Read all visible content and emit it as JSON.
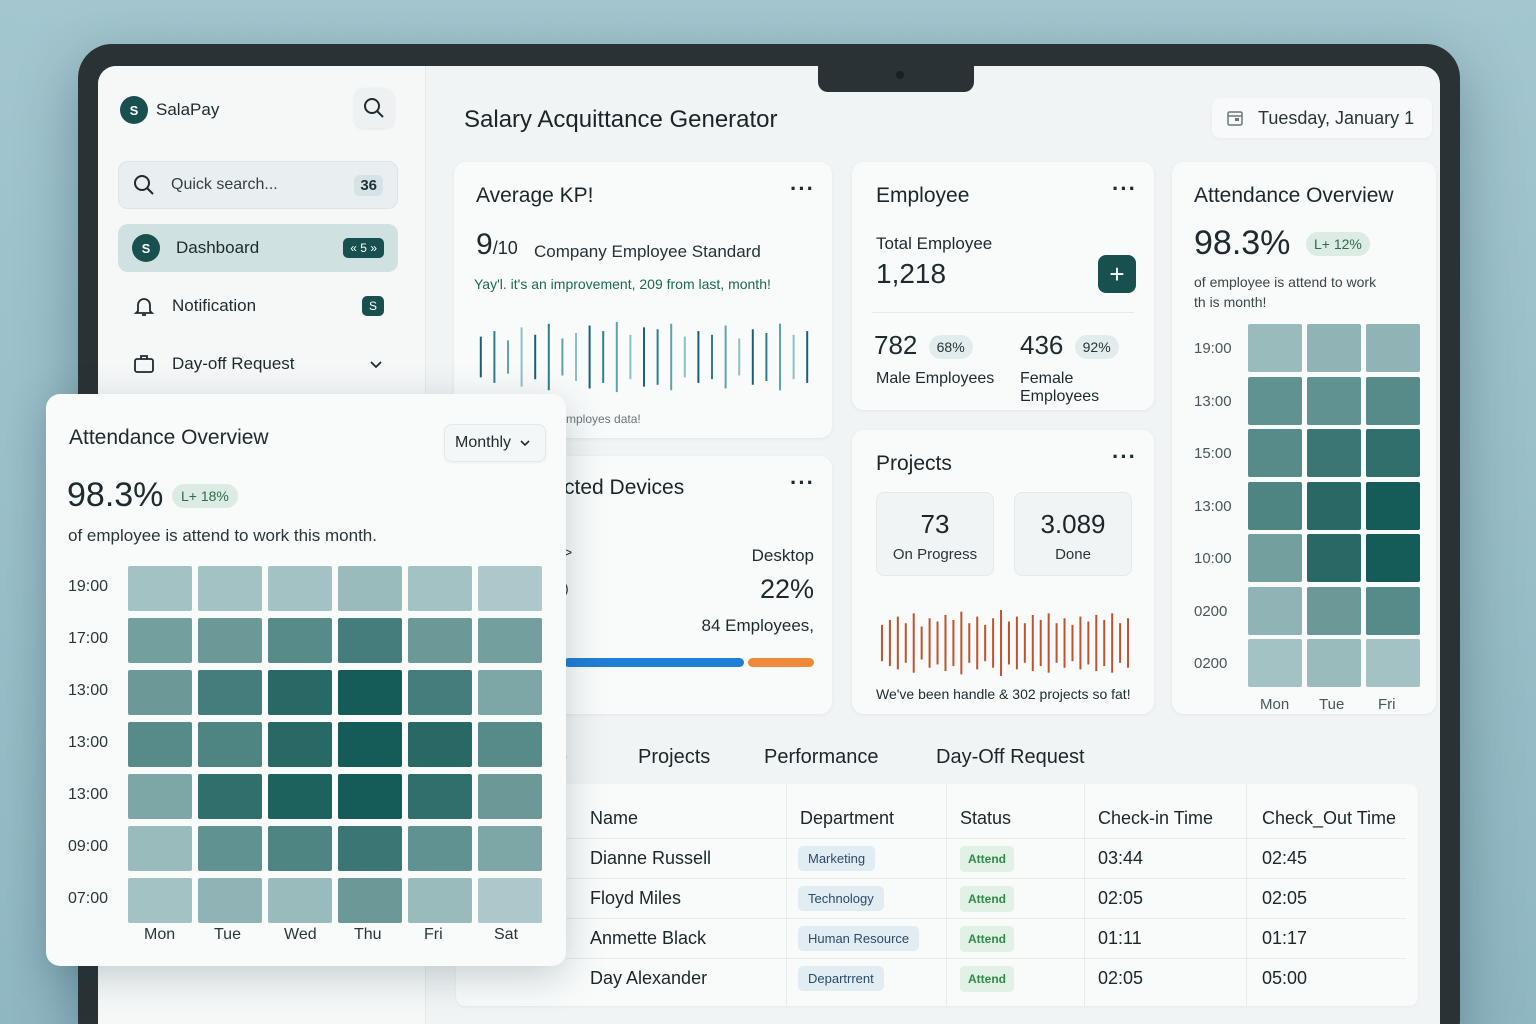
{
  "app": {
    "name": "SalaPay",
    "logo_letter": "S"
  },
  "sidebar": {
    "search_placeholder": "Quick search...",
    "search_badge": "36",
    "items": [
      {
        "label": "Dashboard",
        "badge": "« 5 »",
        "icon": "logo-icon",
        "active": true
      },
      {
        "label": "Notification",
        "badge": "S",
        "icon": "bell-icon"
      },
      {
        "label": "Day-off Request",
        "icon": "briefcase-icon",
        "chevron": "chevron-down-icon"
      }
    ]
  },
  "header": {
    "title": "Salary Acquittance Generator",
    "date": "Tuesday, January 1"
  },
  "kpi": {
    "title": "Average KP!",
    "score": "9",
    "score_suffix": "/10",
    "desc": "Company Employee Standard",
    "note": "Yay'l. it's an improvement, 209 from last, month!",
    "footer": "mployes data!",
    "bars": [
      0.55,
      0.7,
      0.45,
      0.8,
      0.6,
      0.9,
      0.5,
      0.65,
      0.85,
      0.7,
      0.95,
      0.6,
      0.8,
      0.75,
      0.9,
      0.55,
      0.7,
      0.6,
      0.85,
      0.5,
      0.75,
      0.65,
      0.9,
      0.6,
      0.7
    ]
  },
  "employee": {
    "title": "Employee",
    "total_label": "Total Employee",
    "total": "1,218",
    "male_count": "782",
    "male_pct": "68%",
    "male_label": "Male Employees",
    "female_count": "436",
    "female_pct": "92%",
    "female_label": "Female Employees"
  },
  "devices": {
    "title": "cted Devices",
    "left_marks": [
      ">",
      ")"
    ],
    "desktop_label": "Desktop",
    "desktop_pct": "22%",
    "desktop_count": "84 Employees,",
    "blue_share": 0.72,
    "orange_share": 0.28,
    "colors": {
      "blue": "#1f7fd6",
      "orange": "#f0883a"
    }
  },
  "projects": {
    "title": "Projects",
    "in_progress": "73",
    "in_progress_label": "On Progress",
    "done": "3.089",
    "done_label": "Done",
    "note": "We've been handle & 302 projects so fat!",
    "bars": [
      0.55,
      0.7,
      0.8,
      0.6,
      0.9,
      0.5,
      0.75,
      0.65,
      0.85,
      0.7,
      0.95,
      0.6,
      0.8,
      0.55,
      0.75,
      1.0,
      0.65,
      0.8,
      0.6,
      0.85,
      0.7,
      0.9,
      0.6,
      0.75,
      0.55,
      0.8,
      0.65,
      0.85,
      0.7,
      0.9,
      0.6,
      0.75
    ],
    "color": "#c0532e"
  },
  "attendance_right": {
    "title": "Attendance Overview",
    "pct": "98.3%",
    "chip": "L+ 12%",
    "desc_line1": "of employee is attend to work",
    "desc_line2": "th is month!",
    "times": [
      "19:00",
      "13:00",
      "15:00",
      "13:00",
      "10:00",
      "0200",
      "0200"
    ],
    "days": [
      "Mon",
      "Tue",
      "Fri"
    ],
    "levels": [
      [
        0.25,
        0.3,
        0.3
      ],
      [
        0.55,
        0.55,
        0.6
      ],
      [
        0.6,
        0.75,
        0.8
      ],
      [
        0.65,
        0.85,
        0.95
      ],
      [
        0.45,
        0.85,
        0.95
      ],
      [
        0.3,
        0.5,
        0.6
      ],
      [
        0.2,
        0.25,
        0.2
      ]
    ]
  },
  "tabs": [
    "e",
    "Projects",
    "Performance",
    "Day-Off Request"
  ],
  "table": {
    "headers": [
      "Name",
      "Department",
      "Status",
      "Check-in Time",
      "Check_Out Time"
    ],
    "rows": [
      {
        "name": "Dianne Russell",
        "dept": "Marketing",
        "status": "Attend",
        "in": "03:44",
        "out": "02:45"
      },
      {
        "name": "Floyd Miles",
        "dept": "Technology",
        "status": "Attend",
        "in": "02:05",
        "out": "02:05"
      },
      {
        "name": "Anmette Black",
        "dept": "Human Resource",
        "status": "Attend",
        "in": "01:11",
        "out": "01:17"
      },
      {
        "name": "Day Alexander",
        "dept": "Departrrent",
        "status": "Attend",
        "in": "02:05",
        "out": "05:00"
      }
    ]
  },
  "overlay": {
    "title": "Attendance Overview",
    "dropdown": "Monthly",
    "pct": "98.3%",
    "chip": "L+ 18%",
    "desc": "of employee is attend to work this month.",
    "times": [
      "19:00",
      "17:00",
      "13:00",
      "13:00",
      "13:00",
      "09:00",
      "07:00"
    ],
    "days": [
      "Mon",
      "Tue",
      "Wed",
      "Thu",
      "Fri",
      "Sat"
    ],
    "levels": [
      [
        0.2,
        0.2,
        0.2,
        0.25,
        0.2,
        0.15
      ],
      [
        0.45,
        0.5,
        0.6,
        0.7,
        0.5,
        0.45
      ],
      [
        0.5,
        0.7,
        0.85,
        0.95,
        0.7,
        0.4
      ],
      [
        0.6,
        0.65,
        0.85,
        0.95,
        0.85,
        0.6
      ],
      [
        0.4,
        0.8,
        0.9,
        0.95,
        0.8,
        0.5
      ],
      [
        0.25,
        0.55,
        0.65,
        0.75,
        0.55,
        0.4
      ],
      [
        0.2,
        0.3,
        0.25,
        0.5,
        0.25,
        0.15
      ]
    ],
    "colors": {
      "low": "#c9dde0",
      "high": "#0b5450"
    }
  }
}
